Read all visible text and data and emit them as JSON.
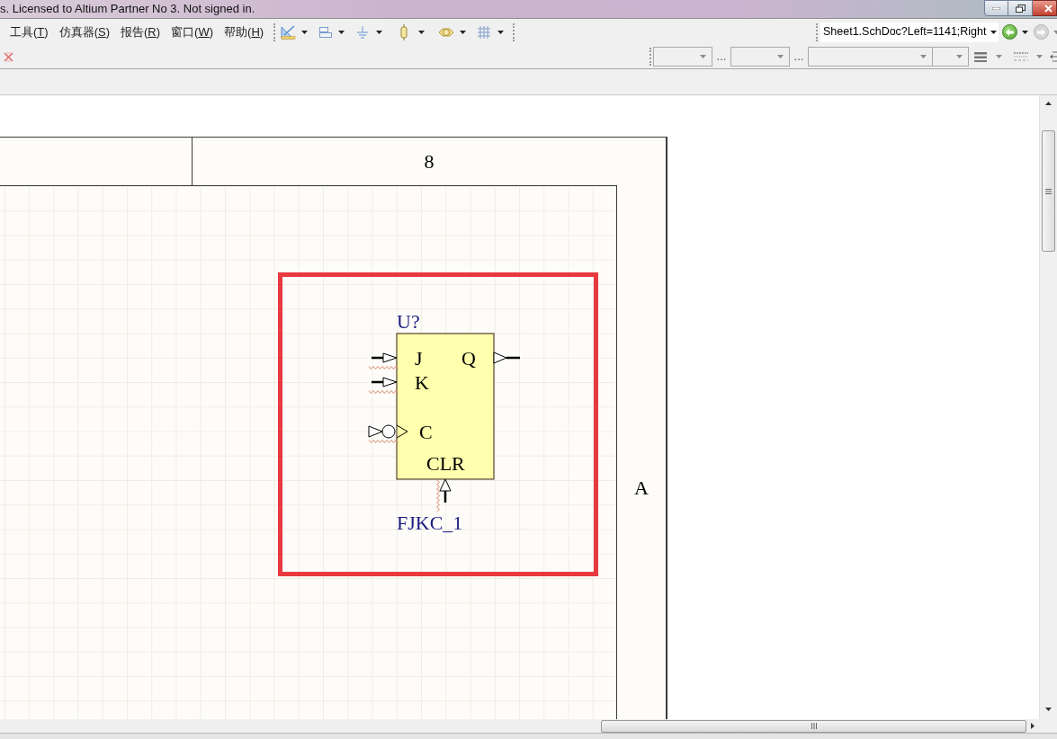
{
  "title_bar": {
    "title": "s. Licensed to Altium Partner No 3. Not signed in."
  },
  "menu": [
    "工具(T)",
    "仿真器(S)",
    "报告(R)",
    "窗口(W)",
    "帮助(H)"
  ],
  "navigation": {
    "address": "Sheet1.SchDoc?Left=1141;Right",
    "back": {
      "disabled": false
    },
    "forward": {
      "disabled": true
    }
  },
  "format_toolbar": {
    "separators": [
      "...",
      "..."
    ]
  },
  "sheet": {
    "column_label": "8",
    "row_label": "A",
    "component": {
      "designator": "U?",
      "comment": "FJKC_1",
      "pins": [
        {
          "name": "J",
          "kind": "input",
          "flagged": true
        },
        {
          "name": "Q",
          "kind": "output",
          "flagged": false
        },
        {
          "name": "K",
          "kind": "input",
          "flagged": true
        },
        {
          "name": "C",
          "kind": "clock",
          "flagged": true
        },
        {
          "name": "CLR",
          "kind": "bottom_input",
          "flagged": true
        }
      ]
    }
  }
}
